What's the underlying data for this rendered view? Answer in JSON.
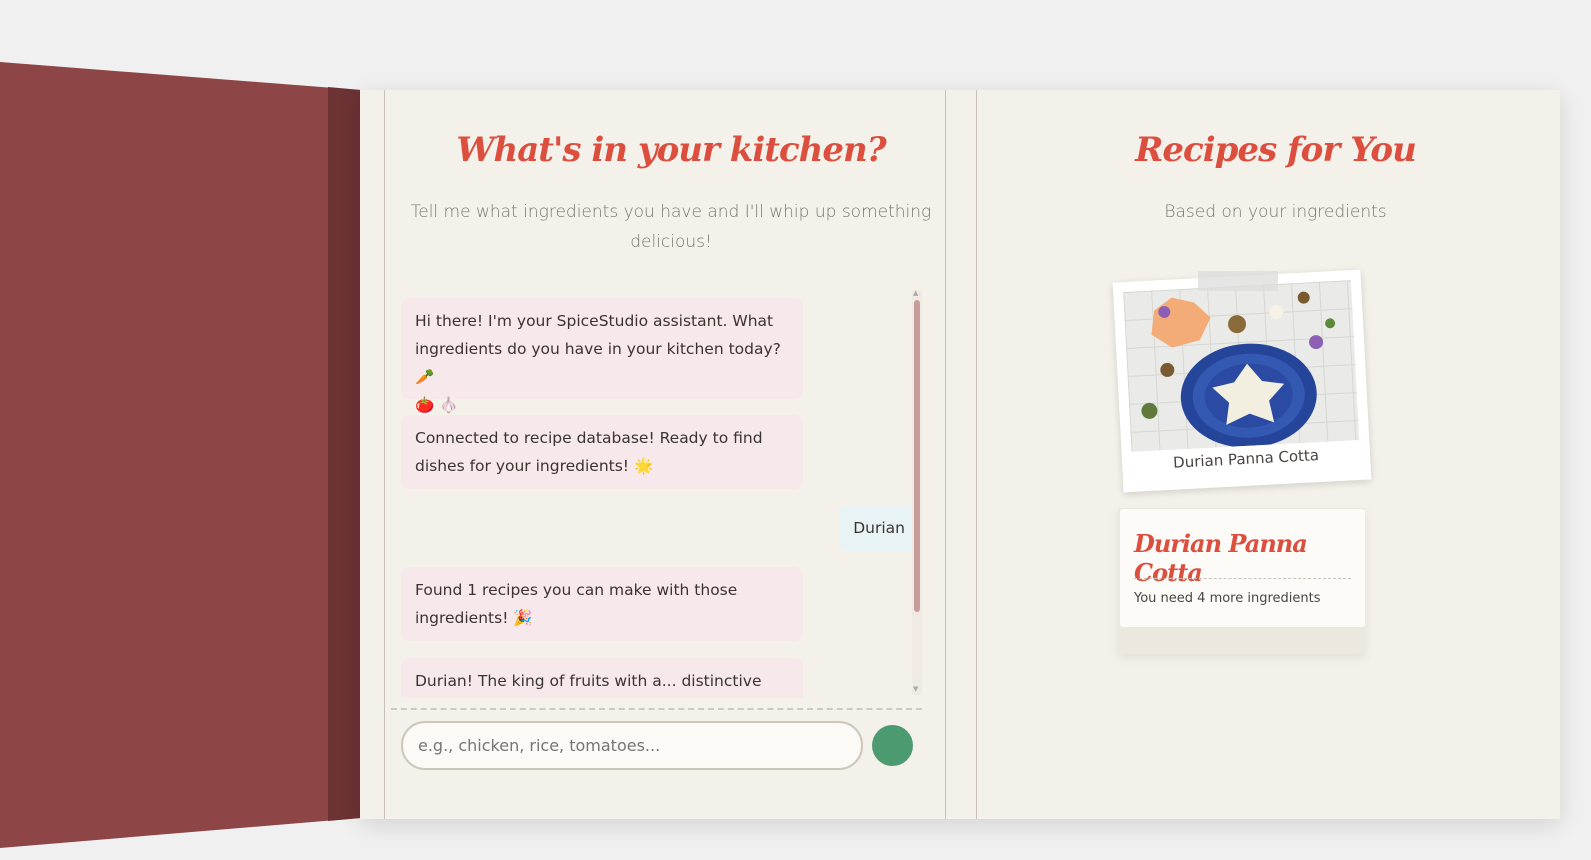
{
  "left_page": {
    "title": "What's in your kitchen?",
    "subtitle_line1": "Tell me what ingredients you have and I'll whip up something",
    "subtitle_line2": "delicious!"
  },
  "chat": {
    "messages": [
      {
        "from": "bot",
        "lines": [
          "Hi there! I'm your SpiceStudio assistant. What",
          "ingredients do you have in your kitchen today? 🥕",
          "🍅 🧄"
        ]
      },
      {
        "from": "bot",
        "lines": [
          "Connected to recipe database! Ready to find",
          "dishes for your ingredients! 🌟"
        ]
      },
      {
        "from": "user",
        "lines": [
          "Durian"
        ]
      },
      {
        "from": "bot",
        "lines": [
          "Found 1 recipes you can make with those",
          "ingredients! 🎉"
        ]
      },
      {
        "from": "bot",
        "lines": [
          "Durian! The king of fruits with a... distinctive smell!"
        ]
      }
    ]
  },
  "input": {
    "placeholder": "e.g., chicken, rice, tomatoes..."
  },
  "right_page": {
    "title": "Recipes for You",
    "subtitle": "Based on your ingredients"
  },
  "recipe": {
    "photo_caption": "Durian Panna Cotta",
    "card_title": "Durian Panna Cotta",
    "card_note": "You need 4 more ingredients"
  },
  "colors": {
    "accent": "#dc4f3f",
    "send_button": "#4c9b70",
    "cover": "#8e4546",
    "page": "#f4f1ea",
    "bot_bubble": "#f7e8ec",
    "user_bubble": "#e8f3f5"
  }
}
